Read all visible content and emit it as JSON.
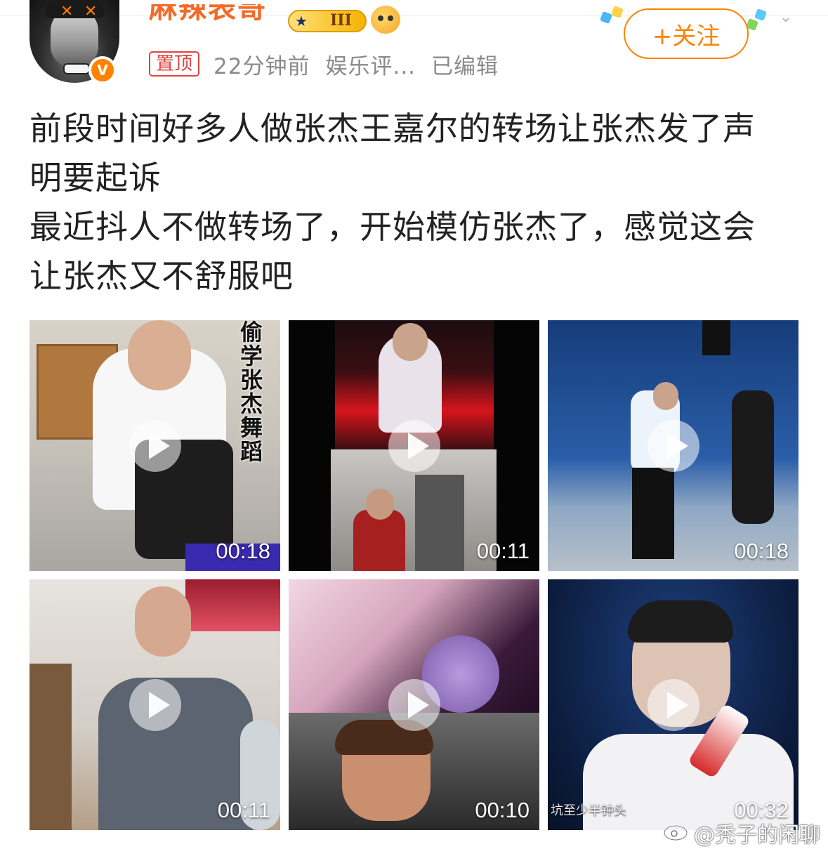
{
  "author": {
    "name": "麻辣表哥",
    "level": "III",
    "verified_mark": "V"
  },
  "post_meta": {
    "pinned_label": "置顶",
    "time": "22分钟前",
    "source": "娱乐评...",
    "edited": "已编辑"
  },
  "follow_button": {
    "label": "+关注"
  },
  "post": {
    "lines": [
      "前段时间好多人做张杰王嘉尔的转场让张杰发了声",
      "明要起诉",
      "最近抖人不做转场了，开始模仿张杰了，感觉这会",
      "让张杰又不舒服吧"
    ]
  },
  "videos": [
    {
      "duration": "00:18",
      "overlay_text": "偷学张杰舞蹈"
    },
    {
      "duration": "00:11"
    },
    {
      "duration": "00:18"
    },
    {
      "duration": "00:11"
    },
    {
      "duration": "00:10"
    },
    {
      "duration": "00:32",
      "caption": "坑至少半钟头"
    }
  ],
  "watermark": "@秃子的闲聊",
  "colors": {
    "accent_orange": "#ff8200",
    "username_orange": "#f26a26",
    "pin_red": "#e0443e",
    "meta_gray": "#8a8a8a"
  },
  "icons": [
    "verified-icon",
    "level-badge-icon",
    "emoji-badge-icon",
    "more-chevron-icon",
    "play-icon",
    "weibo-logo-icon"
  ]
}
